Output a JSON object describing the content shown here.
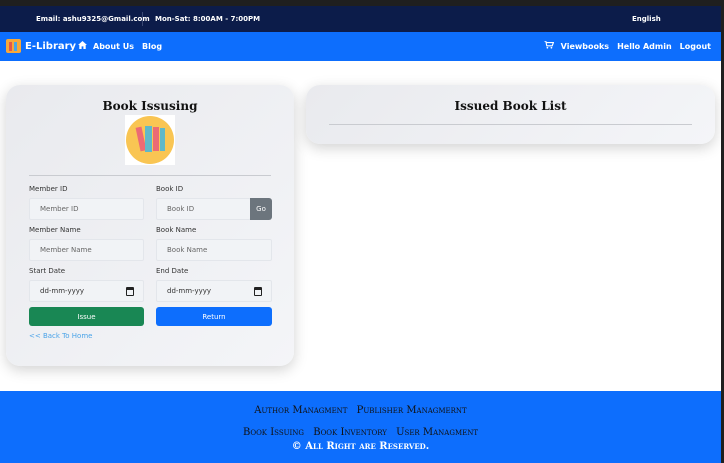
{
  "topbar": {
    "email": "Email: ashu9325@Gmail.com",
    "hours": "Mon-Sat: 8:00AM - 7:00PM",
    "language": "English"
  },
  "navbar": {
    "brand": "E-Library",
    "about": "About Us",
    "blog": "Blog",
    "viewbooks": "Viewbooks",
    "hello": "Hello Admin",
    "logout": "Logout"
  },
  "issuing": {
    "title": "Book Issusing",
    "member_id_label": "Member ID",
    "member_id_placeholder": "Member ID",
    "book_id_label": "Book ID",
    "book_id_placeholder": "Book ID",
    "go": "Go",
    "member_name_label": "Member Name",
    "member_name_placeholder": "Member Name",
    "book_name_label": "Book Name",
    "book_name_placeholder": "Book Name",
    "start_date_label": "Start Date",
    "start_date_value": "dd-mm-yyyy",
    "end_date_label": "End Date",
    "end_date_value": "dd-mm-yyyy",
    "issue": "Issue",
    "return": "Return",
    "back": "<< Back To Home"
  },
  "issued_list": {
    "title": "Issued Book List"
  },
  "footer": {
    "links_row1": [
      "Author Managment",
      "Publisher Managmernt"
    ],
    "links_row2": [
      "Book Issuing",
      "Book Inventory",
      "User Managment"
    ],
    "copyright": "© All Right are Reserved."
  },
  "colors": {
    "topbar": "#0c1c4a",
    "navbar": "#0d6efd",
    "issue_button": "#198754",
    "return_button": "#0d6efd",
    "go_button": "#6c757d",
    "footer": "#0d6efd"
  },
  "icons": {
    "home": "home-icon",
    "cart": "cart-icon",
    "logo": "book-logo-icon",
    "calendar": "calendar-icon"
  }
}
